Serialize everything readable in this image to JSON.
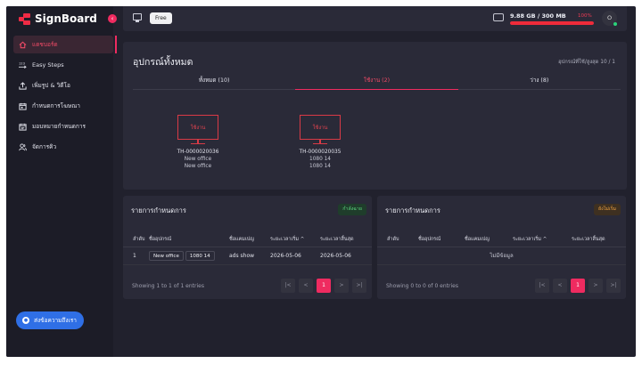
{
  "app": {
    "name": "SignBoard"
  },
  "sidebar": {
    "items": [
      {
        "label": "แดชบอร์ด",
        "icon": "home-icon",
        "active": true
      },
      {
        "label": "Easy Steps",
        "icon": "steps-icon",
        "active": false
      },
      {
        "label": "เพิ่มรูป & วิดีโอ",
        "icon": "upload-icon",
        "active": false
      },
      {
        "label": "กำหนดการโฆษณา",
        "icon": "calendar-icon",
        "active": false
      },
      {
        "label": "มอบหมายกำหนดการ",
        "icon": "calendar-assign-icon",
        "active": false
      },
      {
        "label": "จัดการคิว",
        "icon": "users-icon",
        "active": false
      }
    ],
    "contact_label": "ส่งข้อความถึงเรา"
  },
  "header": {
    "plan": "Free",
    "storage_text": "9.88 GB / 300 MB",
    "storage_percent_label": "100%",
    "storage_percent": 100,
    "avatar_initial": "O"
  },
  "devices": {
    "title": "อุปกรณ์ทั้งหมด",
    "usage_note": "อุปกรณ์ที่ใช้/สูงสุด 10 / 1",
    "tabs": [
      {
        "label": "ทั้งหมด (10)",
        "active": false
      },
      {
        "label": "ใช้งาน (2)",
        "active": true
      },
      {
        "label": "ว่าง (8)",
        "active": false
      }
    ],
    "cards": [
      {
        "screen_label": "ใช้งาน",
        "code": "TH-0000020036",
        "line1": "New office",
        "line2": "New office"
      },
      {
        "screen_label": "ใช้งาน",
        "code": "TH-0000020035",
        "line1": "1080 14",
        "line2": "1080 14"
      }
    ]
  },
  "schedule_active": {
    "title": "รายการกำหนดการ",
    "status": "กำลังฉาย",
    "columns": [
      "ลำดับ",
      "ชื่ออุปกรณ์",
      "ชื่อแคมเปญ",
      "ระยะเวลาเริ่ม ^",
      "ระยะเวลาสิ้นสุด"
    ],
    "rows": [
      {
        "index": "1",
        "device_chips": [
          "New office",
          "1080 14"
        ],
        "campaign": "ads show",
        "start": "2026-05-06",
        "end": "2026-05-06"
      }
    ],
    "footer": "Showing 1 to 1 of 1 entries",
    "pagination": [
      "|<",
      "<",
      "1",
      ">",
      ">|"
    ]
  },
  "schedule_pending": {
    "title": "รายการกำหนดการ",
    "status": "ยังไม่เริ่ม",
    "columns": [
      "ลำดับ",
      "ชื่ออุปกรณ์",
      "ชื่อแคมเปญ",
      "ระยะเวลาเริ่ม ^",
      "ระยะเวลาสิ้นสุด"
    ],
    "empty_text": "ไม่มีข้อมูล",
    "footer": "Showing 0 to 0 of 0 entries",
    "pagination": [
      "|<",
      "<",
      "1",
      ">",
      ">|"
    ]
  }
}
